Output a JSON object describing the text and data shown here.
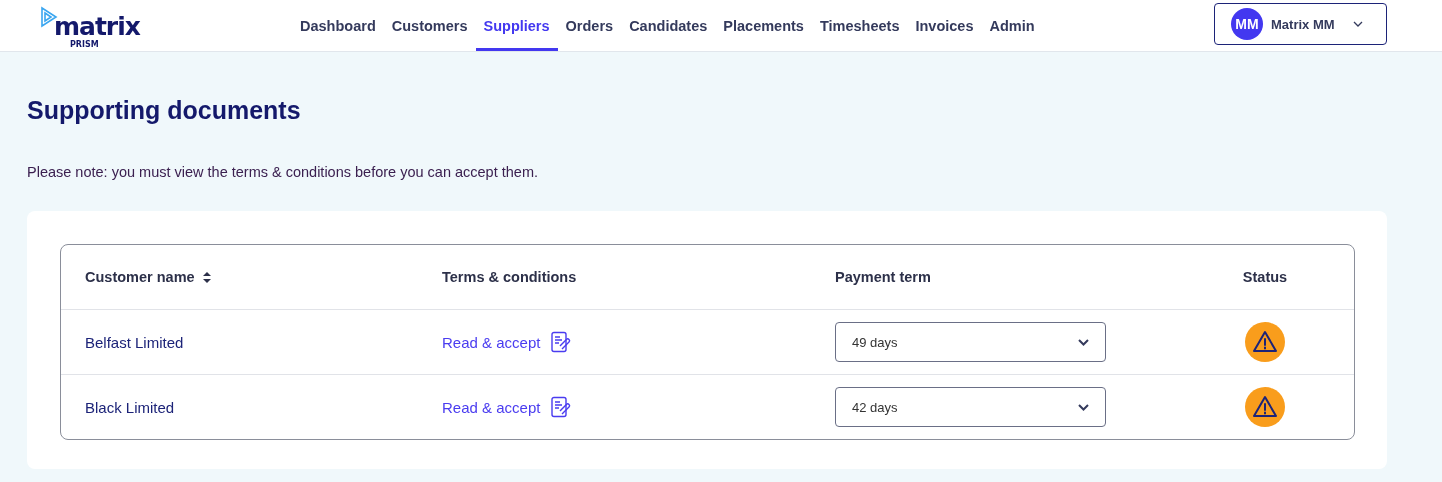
{
  "header": {
    "logo": {
      "name": "matrix",
      "tagline": "PRISM"
    },
    "nav": [
      {
        "label": "Dashboard",
        "selected": false
      },
      {
        "label": "Customers",
        "selected": false
      },
      {
        "label": "Suppliers",
        "selected": true
      },
      {
        "label": "Orders",
        "selected": false
      },
      {
        "label": "Candidates",
        "selected": false
      },
      {
        "label": "Placements",
        "selected": false
      },
      {
        "label": "Timesheets",
        "selected": false
      },
      {
        "label": "Invoices",
        "selected": false
      },
      {
        "label": "Admin",
        "selected": false
      }
    ],
    "user": {
      "initials": "MM",
      "name": "Matrix MM"
    }
  },
  "title": "Supporting documents",
  "note": "Please note: you must view the terms & conditions before you can accept them.",
  "table": {
    "columns": [
      {
        "label": "Customer name",
        "sortable": true
      },
      {
        "label": "Terms & conditions",
        "sortable": false
      },
      {
        "label": "Payment term",
        "sortable": false
      },
      {
        "label": "Status",
        "sortable": false
      }
    ],
    "rows": [
      {
        "customer": "Belfast Limited",
        "terms_link": "Read & accept",
        "payment_term": "49 days",
        "kind": "warning"
      },
      {
        "customer": "Black Limited",
        "terms_link": "Read & accept",
        "payment_term": "42 days",
        "kind": "warning"
      }
    ]
  }
}
